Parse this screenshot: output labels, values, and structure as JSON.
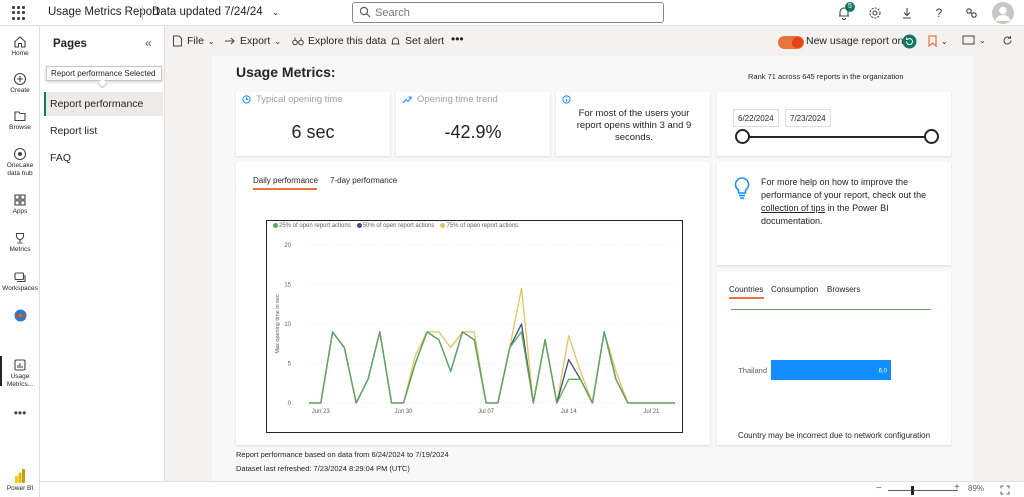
{
  "app": {
    "title": "Usage Metrics Report",
    "data_updated": "Data updated 7/24/24",
    "search_placeholder": "Search",
    "notification_count": "5"
  },
  "leftnav": [
    {
      "label": "Home",
      "icon": "home-icon"
    },
    {
      "label": "Create",
      "icon": "create-icon"
    },
    {
      "label": "Browse",
      "icon": "browse-icon"
    },
    {
      "label": "OneLake",
      "label2": "data hub",
      "icon": "onelake-icon"
    },
    {
      "label": "Apps",
      "icon": "apps-icon"
    },
    {
      "label": "Metrics",
      "icon": "metrics-icon"
    },
    {
      "label": "Workspaces",
      "icon": "workspaces-icon"
    },
    {
      "label": "Usage",
      "label2": "Metrics...",
      "icon": "usage-metrics-icon"
    },
    {
      "label": "Power BI",
      "icon": "powerbi-logo-icon"
    }
  ],
  "pages": {
    "title": "Pages",
    "tooltip": "Report performance Selected",
    "items": [
      "Report performance",
      "Report list",
      "FAQ"
    ]
  },
  "toolbar": {
    "file": "File",
    "export": "Export",
    "explore": "Explore this data",
    "alert": "Set alert",
    "new_usage": "New usage report on"
  },
  "report": {
    "title": "Usage Metrics:",
    "rank": "Rank 71 across 645 reports in the organization",
    "kpi1_label": "Typical opening time",
    "kpi1_value": "6 sec",
    "kpi2_label": "Opening time trend",
    "kpi2_value": "-42.9%",
    "kpi3_text": "For most of the users your report opens within 3 and 9 seconds.",
    "date_start": "6/22/2024",
    "date_end": "7/23/2024",
    "tab_daily": "Daily performance",
    "tab_7day": "7-day performance",
    "help_text_1": "For more help on how to improve the performance of your report, check out the ",
    "help_link": "collection of tips",
    "help_text_2": " in the Power BI documentation.",
    "tab_countries": "Countries",
    "tab_consumption": "Consumption",
    "tab_browsers": "Browsers",
    "country_note": "Country may be incorrect due to network configuration",
    "footer1": "Report performance based on data from 6/24/2024 to 7/19/2024",
    "footer2": "Dataset last refreshed: 7/23/2024 8:29:04 PM (UTC)"
  },
  "colors": {
    "green": "#5fa85f",
    "navy": "#3b4f7a",
    "yellow": "#e6c45a",
    "blue_bar": "#118dff",
    "accent": "#e8743b"
  },
  "chart_data": [
    {
      "type": "line",
      "ylabel": "Max opening time in sec",
      "ylim": [
        0,
        20
      ],
      "yticks": [
        0,
        5,
        10,
        15,
        20
      ],
      "xtick_labels": [
        "Jun 23",
        "Jun 30",
        "Jul 07",
        "Jul 14",
        "Jul 21"
      ],
      "x": [
        "6/22",
        "6/23",
        "6/24",
        "6/25",
        "6/26",
        "6/27",
        "6/28",
        "6/29",
        "6/30",
        "7/1",
        "7/2",
        "7/3",
        "7/4",
        "7/5",
        "7/6",
        "7/7",
        "7/8",
        "7/9",
        "7/10",
        "7/11",
        "7/12",
        "7/13",
        "7/14",
        "7/15",
        "7/16",
        "7/17",
        "7/18",
        "7/19",
        "7/20",
        "7/21",
        "7/22",
        "7/23"
      ],
      "series": [
        {
          "name": "25% of open report actions",
          "color": "#5fa85f",
          "values": [
            0,
            0,
            9,
            7,
            0,
            3,
            9,
            0,
            0,
            5,
            9,
            8,
            4,
            9,
            8,
            0,
            0,
            7,
            9,
            0,
            8,
            0,
            3,
            3,
            0,
            9,
            3,
            0,
            0,
            0,
            0,
            0
          ]
        },
        {
          "name": "50% of open report actions",
          "color": "#3b4f7a",
          "values": [
            0,
            0,
            9,
            7,
            0,
            3,
            9,
            0,
            0,
            5,
            9,
            8,
            4,
            9,
            8,
            0,
            0,
            7,
            10,
            0,
            8,
            0,
            5.5,
            3,
            0,
            9,
            3,
            0,
            0,
            0,
            0,
            0
          ]
        },
        {
          "name": "75% of open report actions",
          "color": "#e6c45a",
          "values": [
            0,
            0,
            9,
            7,
            0,
            3,
            9,
            0,
            0,
            6,
            9,
            9,
            7,
            9,
            9,
            0,
            0,
            7,
            14.5,
            0,
            8,
            0,
            8.5,
            4,
            0,
            9,
            4,
            0,
            0,
            0,
            0,
            0
          ]
        }
      ]
    },
    {
      "type": "bar",
      "orientation": "horizontal",
      "categories": [
        "Thailand"
      ],
      "values": [
        6.0
      ],
      "labels": [
        "6.0"
      ],
      "xlim": [
        0,
        10
      ]
    }
  ],
  "status": {
    "zoom": "89%"
  }
}
